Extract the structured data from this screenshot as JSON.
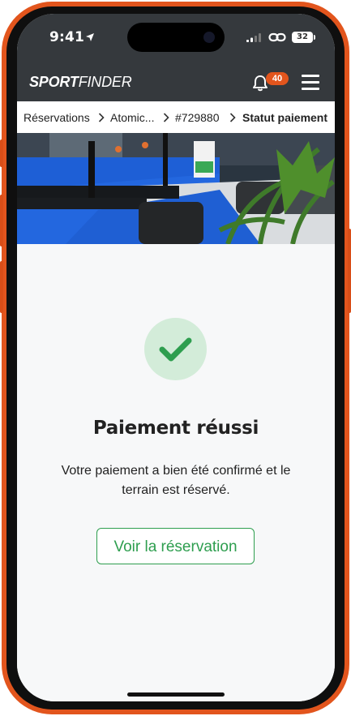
{
  "status_bar": {
    "time": "9:41",
    "battery": "32"
  },
  "header": {
    "logo_bold": "SPORT",
    "logo_rest": "FINDER",
    "notification_count": "40"
  },
  "breadcrumb": {
    "items": [
      "Réservations",
      "Atomic...",
      "#729880",
      "Statut paiement"
    ]
  },
  "main": {
    "title": "Paiement réussi",
    "message": "Votre paiement a bien été confirmé et le terrain est réservé.",
    "button_label": "Voir la réservation"
  },
  "colors": {
    "brand": "#e2551d",
    "header": "#35393d",
    "success": "#2e9e4f",
    "success_bg": "#d3ecd9"
  }
}
